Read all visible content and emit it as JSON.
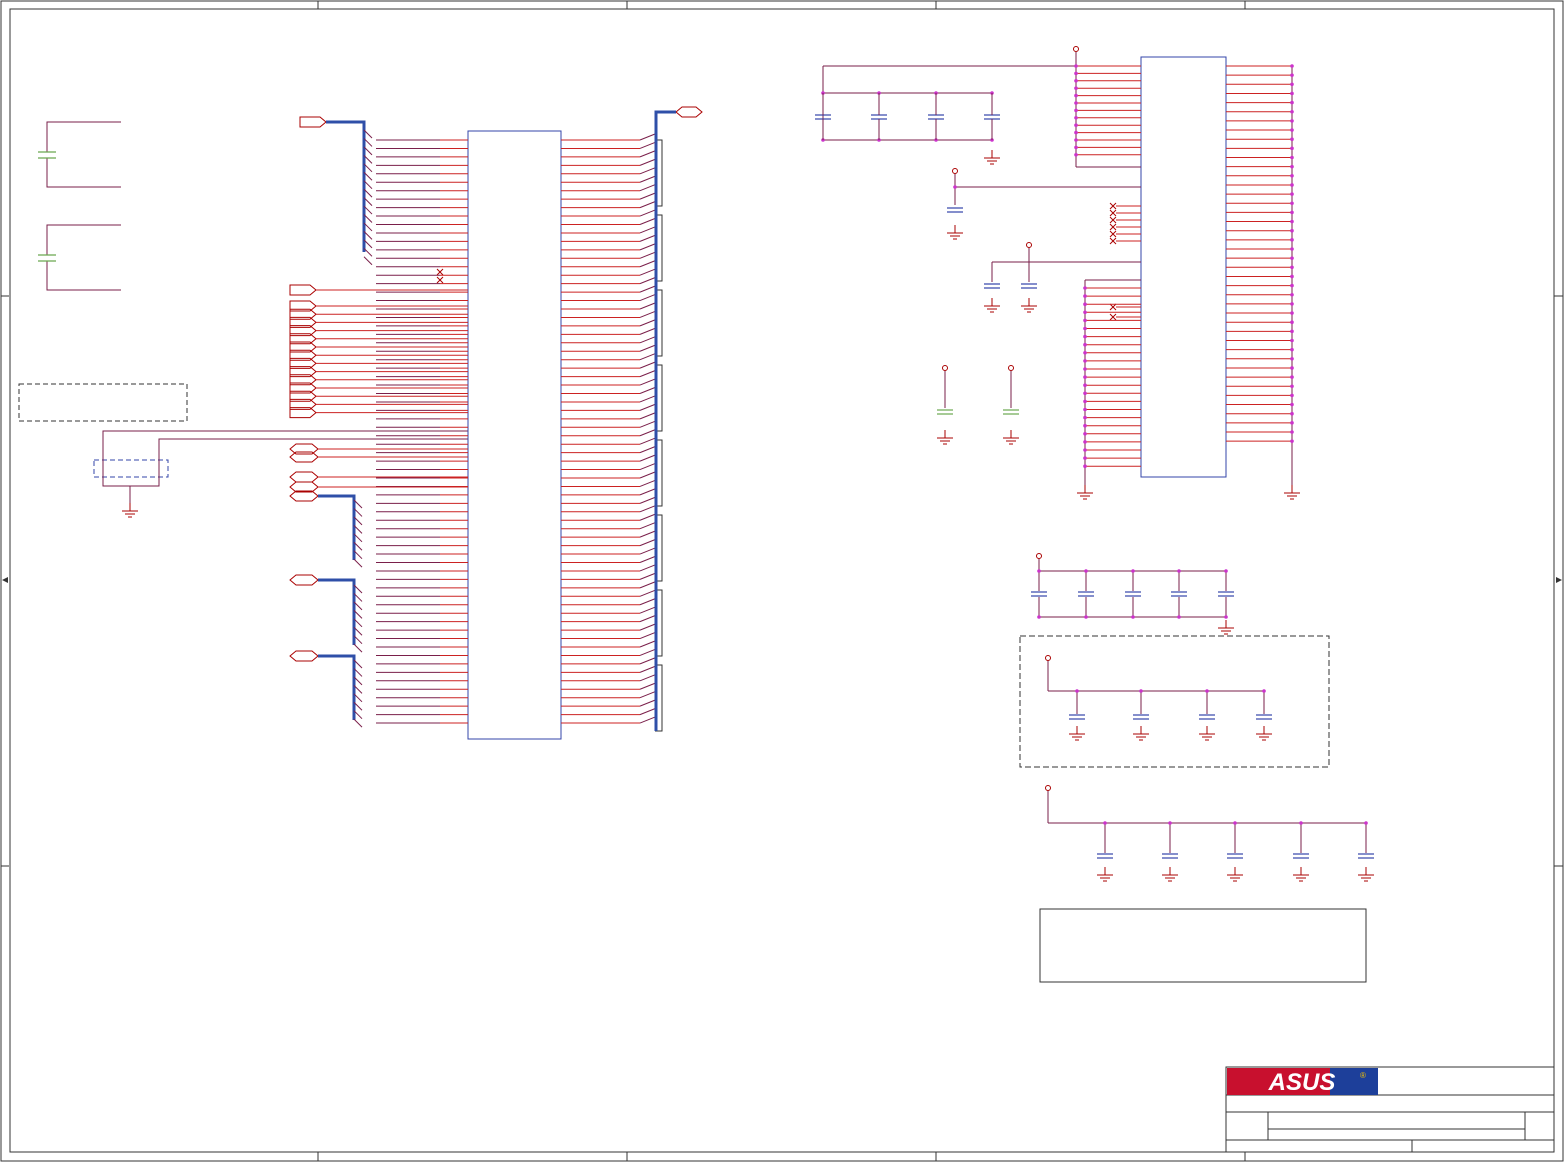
{
  "colors": {
    "wire": "#cc2222",
    "pin": "#aa0000",
    "body": "#3344aa",
    "bus": "#2f4fa8",
    "net": "#7a1f4a",
    "junction": "#cc33cc",
    "cap_alt": "#6aa84f",
    "border": "#333333"
  },
  "title_block": {
    "logo_text": "ASUS",
    "logo_mark": "®",
    "logo_colors": [
      "#c8102e",
      "#1d3f9a",
      "#f6c200",
      "#0a7a3b"
    ]
  },
  "icons": {
    "ground": "ground-icon",
    "power": "power-port-icon",
    "capacitor": "capacitor-icon",
    "no_connect": "no-connect-icon",
    "off_sheet": "off-sheet-connector-icon",
    "bus": "bus-line-icon",
    "border_arrow": "border-arrow-icon"
  }
}
